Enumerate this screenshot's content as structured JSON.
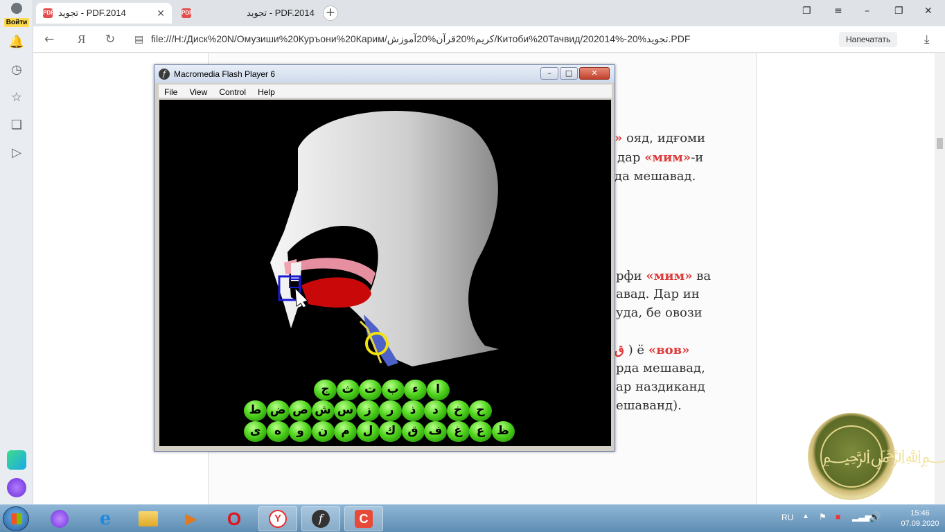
{
  "browser": {
    "login_label": "Войти",
    "tabs": [
      {
        "title": "تجوید - PDF.2014",
        "active": true
      },
      {
        "title": "تجوید - PDF.2014",
        "active": false
      }
    ],
    "address": {
      "yandex_letter": "Я",
      "url": "file:///H:/Диск%20N/Омузиши%20Куръони%20Карим/کریم%20قرآن%20آموزش/Китоби%20Тачвид/202014%-20%تجوید.PDF",
      "print_label": "Напечатать"
    }
  },
  "pdf": {
    "lines": [
      {
        "pre": "",
        "hl": "»",
        "post": " ояд, идғоми"
      },
      {
        "pre": "дар ",
        "hl": "«мим»",
        "post": "-и"
      },
      {
        "pre": "да мешавад.",
        "hl": "",
        "post": ""
      },
      {
        "pre": "рфи ",
        "hl": "«мим»",
        "post": " ва"
      },
      {
        "pre": "авад. Дар ин",
        "hl": "",
        "post": ""
      },
      {
        "pre": "уда, бе овози",
        "hl": "",
        "post": ""
      },
      {
        "pre": "",
        "hl": "ق",
        "post": " ) ё "
      },
      {
        "pre": "рда мешавад,",
        "hl": "",
        "post": ""
      },
      {
        "pre": "ар наздиканд",
        "hl": "",
        "post": ""
      },
      {
        "pre": "ешаванд).",
        "hl": "",
        "post": ""
      }
    ],
    "vov_label": "«вов»"
  },
  "flash": {
    "title": "Macromedia Flash Player 6",
    "menu": [
      "File",
      "View",
      "Control",
      "Help"
    ],
    "letters_row1": [
      "ا",
      "ء",
      "ب",
      "ت",
      "ث",
      "ج"
    ],
    "letters_row2": [
      "ح",
      "خ",
      "د",
      "ذ",
      "ر",
      "ز",
      "س",
      "ش",
      "ص",
      "ض",
      "ط"
    ],
    "letters_row3": [
      "ظ",
      "ع",
      "غ",
      "ف",
      "ق",
      "ك",
      "ل",
      "م",
      "ن",
      "و",
      "ه",
      "ى"
    ]
  },
  "taskbar": {
    "lang": "RU",
    "time": "15:46",
    "date": "07.09.2020"
  },
  "emblem_text": "القرآن الكريم"
}
